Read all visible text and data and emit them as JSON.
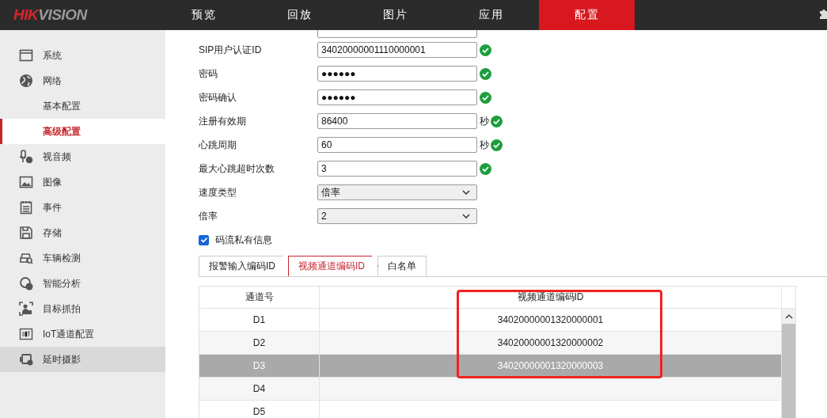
{
  "header": {
    "logo": {
      "red": "HIK",
      "grey": "VISION"
    },
    "nav": [
      {
        "label": "预览",
        "selected": false
      },
      {
        "label": "回放",
        "selected": false
      },
      {
        "label": "图片",
        "selected": false
      },
      {
        "label": "应用",
        "selected": false
      },
      {
        "label": "配置",
        "selected": true
      }
    ]
  },
  "sidebar": {
    "items": [
      {
        "label": "系统",
        "selected": false,
        "highlighted": false
      },
      {
        "label": "网络",
        "selected": false,
        "highlighted": false,
        "children": [
          {
            "label": "基本配置",
            "selected": false
          },
          {
            "label": "高级配置",
            "selected": true
          }
        ]
      },
      {
        "label": "视音频",
        "selected": false,
        "highlighted": false
      },
      {
        "label": "图像",
        "selected": false,
        "highlighted": false
      },
      {
        "label": "事件",
        "selected": false,
        "highlighted": false
      },
      {
        "label": "存储",
        "selected": false,
        "highlighted": false
      },
      {
        "label": "车辆检测",
        "selected": false,
        "highlighted": false
      },
      {
        "label": "智能分析",
        "selected": false,
        "highlighted": false
      },
      {
        "label": "目标抓拍",
        "selected": false,
        "highlighted": false
      },
      {
        "label": "IoT通道配置",
        "selected": false,
        "highlighted": false
      },
      {
        "label": "延时摄影",
        "selected": false,
        "highlighted": true
      }
    ]
  },
  "form": {
    "fields": [
      {
        "kind": "text",
        "label": "SIP用户认证ID",
        "value": "34020000001110000001",
        "valid": true
      },
      {
        "kind": "text",
        "label": "密码",
        "value": "●●●●●●",
        "valid": true
      },
      {
        "kind": "text",
        "label": "密码确认",
        "value": "●●●●●●",
        "valid": true
      },
      {
        "kind": "text",
        "label": "注册有效期",
        "value": "86400",
        "unit": "秒",
        "valid": true
      },
      {
        "kind": "text",
        "label": "心跳周期",
        "value": "60",
        "unit": "秒",
        "valid": true
      },
      {
        "kind": "text",
        "label": "最大心跳超时次数",
        "value": "3",
        "valid": true
      },
      {
        "kind": "select",
        "label": "速度类型",
        "value": "倍率"
      },
      {
        "kind": "select",
        "label": "倍率",
        "value": "2"
      }
    ],
    "checkbox": {
      "label": "码流私有信息",
      "checked": true
    }
  },
  "tabs": [
    {
      "label": "报警输入编码ID",
      "selected": false
    },
    {
      "label": "视频通道编码ID",
      "selected": true
    },
    {
      "label": "白名单",
      "selected": false
    }
  ],
  "table": {
    "columns": [
      "通道号",
      "视频通道编码ID"
    ],
    "rows": [
      {
        "channel": "D1",
        "code": "34020000001320000001",
        "selected": false
      },
      {
        "channel": "D2",
        "code": "34020000001320000002",
        "selected": false
      },
      {
        "channel": "D3",
        "code": "34020000001320000003",
        "selected": true
      },
      {
        "channel": "D4",
        "selected": false
      },
      {
        "channel": "D5",
        "selected": false
      }
    ]
  }
}
